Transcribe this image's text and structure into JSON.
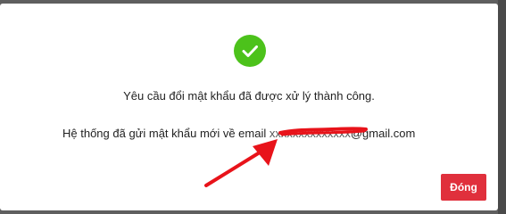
{
  "dialog": {
    "message_line1": "Yêu cầu đổi mật khẩu đã được xử lý thành công.",
    "message_line2_prefix": "Hệ thống đã gửi mật khẩu mới về email ",
    "email_masked": "xxxxxxxxxxxxxx",
    "email_suffix": "@gmail.com",
    "close_label": "Đóng"
  },
  "colors": {
    "success": "#4cc21b",
    "button": "#e0303c",
    "annotation": "#e8131a"
  },
  "icons": {
    "status": "check-circle-icon",
    "annotation": "red-arrow-annotation"
  }
}
